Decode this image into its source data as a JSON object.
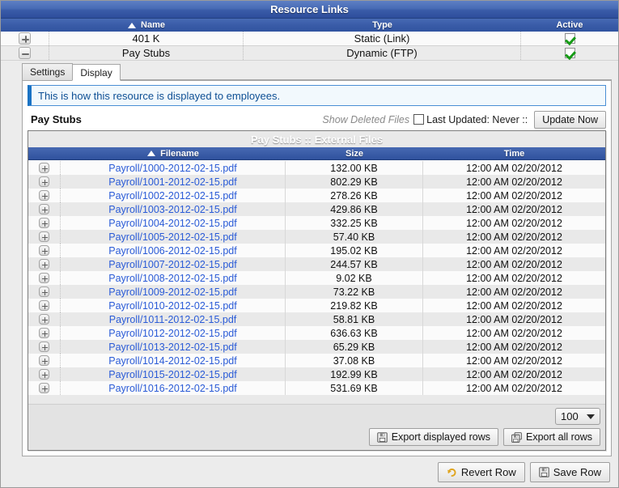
{
  "window": {
    "title": "Resource Links"
  },
  "resource_grid": {
    "columns": [
      "Name",
      "Type",
      "Active"
    ],
    "sort_column": "Name",
    "sort_direction": "asc",
    "rows": [
      {
        "expander": "plus",
        "name": "401 K",
        "type": "Static (Link)",
        "active": true
      },
      {
        "expander": "minus",
        "name": "Pay Stubs",
        "type": "Dynamic (FTP)",
        "active": true
      }
    ]
  },
  "tabs": {
    "items": [
      {
        "label": "Settings",
        "active": false
      },
      {
        "label": "Display",
        "active": true
      }
    ]
  },
  "panel": {
    "info_message": "This is how this resource is displayed to employees.",
    "resource_title": "Pay Stubs",
    "show_deleted_label": "Show Deleted Files",
    "show_deleted_checked": false,
    "last_updated_text": "Last Updated: Never ::",
    "update_now_label": "Update Now"
  },
  "files_grid": {
    "title": "Pay Stubs :: External Files",
    "columns": [
      "Filename",
      "Size",
      "Time"
    ],
    "sort_column": "Filename",
    "sort_direction": "asc",
    "rows": [
      {
        "filename": "Payroll/1000-2012-02-15.pdf",
        "size": "132.00 KB",
        "time": "12:00 AM 02/20/2012"
      },
      {
        "filename": "Payroll/1001-2012-02-15.pdf",
        "size": "802.29 KB",
        "time": "12:00 AM 02/20/2012"
      },
      {
        "filename": "Payroll/1002-2012-02-15.pdf",
        "size": "278.26 KB",
        "time": "12:00 AM 02/20/2012"
      },
      {
        "filename": "Payroll/1003-2012-02-15.pdf",
        "size": "429.86 KB",
        "time": "12:00 AM 02/20/2012"
      },
      {
        "filename": "Payroll/1004-2012-02-15.pdf",
        "size": "332.25 KB",
        "time": "12:00 AM 02/20/2012"
      },
      {
        "filename": "Payroll/1005-2012-02-15.pdf",
        "size": "57.40 KB",
        "time": "12:00 AM 02/20/2012"
      },
      {
        "filename": "Payroll/1006-2012-02-15.pdf",
        "size": "195.02 KB",
        "time": "12:00 AM 02/20/2012"
      },
      {
        "filename": "Payroll/1007-2012-02-15.pdf",
        "size": "244.57 KB",
        "time": "12:00 AM 02/20/2012"
      },
      {
        "filename": "Payroll/1008-2012-02-15.pdf",
        "size": "9.02 KB",
        "time": "12:00 AM 02/20/2012"
      },
      {
        "filename": "Payroll/1009-2012-02-15.pdf",
        "size": "73.22 KB",
        "time": "12:00 AM 02/20/2012"
      },
      {
        "filename": "Payroll/1010-2012-02-15.pdf",
        "size": "219.82 KB",
        "time": "12:00 AM 02/20/2012"
      },
      {
        "filename": "Payroll/1011-2012-02-15.pdf",
        "size": "58.81 KB",
        "time": "12:00 AM 02/20/2012"
      },
      {
        "filename": "Payroll/1012-2012-02-15.pdf",
        "size": "636.63 KB",
        "time": "12:00 AM 02/20/2012"
      },
      {
        "filename": "Payroll/1013-2012-02-15.pdf",
        "size": "65.29 KB",
        "time": "12:00 AM 02/20/2012"
      },
      {
        "filename": "Payroll/1014-2012-02-15.pdf",
        "size": "37.08 KB",
        "time": "12:00 AM 02/20/2012"
      },
      {
        "filename": "Payroll/1015-2012-02-15.pdf",
        "size": "192.99 KB",
        "time": "12:00 AM 02/20/2012"
      },
      {
        "filename": "Payroll/1016-2012-02-15.pdf",
        "size": "531.69 KB",
        "time": "12:00 AM 02/20/2012"
      }
    ],
    "page_size": "100",
    "export_displayed_label": "Export displayed rows",
    "export_all_label": "Export all rows"
  },
  "action_bar": {
    "revert_label": "Revert Row",
    "save_label": "Save Row"
  },
  "colors": {
    "header_blue": "#3a5ca8",
    "link_blue": "#2a5bd7",
    "info_blue": "#0d4f94",
    "check_green": "#169b16"
  }
}
